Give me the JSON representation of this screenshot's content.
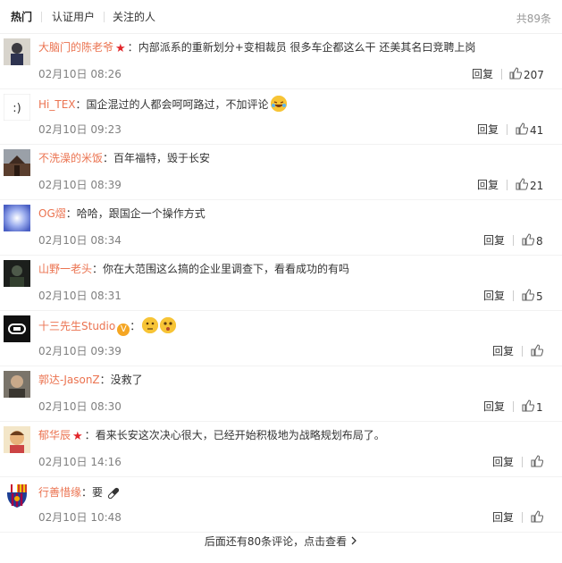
{
  "tabs": [
    {
      "label": "热门",
      "active": true
    },
    {
      "label": "认证用户",
      "active": false
    },
    {
      "label": "关注的人",
      "active": false
    }
  ],
  "total_count": "共89条",
  "reply_label": "回复",
  "comments": [
    {
      "user": "大脑门的陈老爷",
      "badge": "star",
      "text": "内部派系的重新划分+变相裁员 很多车企都这么干 还美其名曰竞聘上岗",
      "time": "02月10日 08:26",
      "likes": "207",
      "avatar": "person-avatar"
    },
    {
      "user": "Hi_TEX",
      "badge": "",
      "text": "国企混过的人都会呵呵路过，不加评论",
      "emoji": "laughing-emoji",
      "time": "02月10日 09:23",
      "likes": "41",
      "avatar": "smiley-text-avatar"
    },
    {
      "user": "不洗澡的米饭",
      "badge": "",
      "text": "百年福特，毁于长安",
      "time": "02月10日 08:39",
      "likes": "21",
      "avatar": "building-avatar"
    },
    {
      "user": "OG熠",
      "badge": "",
      "text": "哈哈，跟国企一个操作方式",
      "time": "02月10日 08:34",
      "likes": "8",
      "avatar": "sky-avatar"
    },
    {
      "user": "山野一老头",
      "badge": "",
      "text": "你在大范围这么搞的企业里调查下，看看成功的有吗",
      "time": "02月10日 08:31",
      "likes": "5",
      "avatar": "dark-photo-avatar"
    },
    {
      "user": "十三先生Studio",
      "badge": "verified",
      "text": "",
      "emoji": "thinking-emojis",
      "time": "02月10日 09:39",
      "likes": "",
      "avatar": "logo-avatar"
    },
    {
      "user": "郭达-JasonZ",
      "badge": "",
      "text": "没救了",
      "time": "02月10日 08:30",
      "likes": "1",
      "avatar": "man-avatar"
    },
    {
      "user": "郁华辰",
      "badge": "star",
      "text": "看来长安这次决心很大，已经开始积极地为战略规划布局了。",
      "time": "02月10日 14:16",
      "likes": "",
      "avatar": "cartoon-avatar"
    },
    {
      "user": "行善惜缘",
      "badge": "",
      "text": "要",
      "emoji": "pill-emoji",
      "time": "02月10日 10:48",
      "likes": "",
      "avatar": "barcelona-crest-avatar"
    }
  ],
  "more_label": "后面还有80条评论，点击查看",
  "colors": {
    "username": "#eb7350",
    "star": "#e2262a",
    "verified": "#f5a623"
  }
}
